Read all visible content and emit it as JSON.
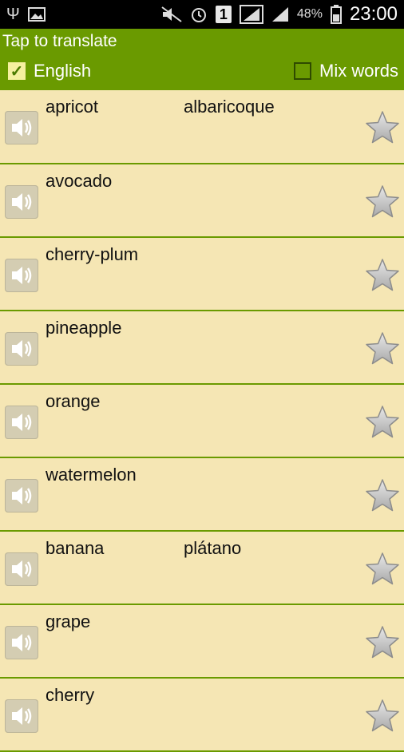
{
  "status_bar": {
    "signal_badge": "1",
    "battery": "48%",
    "time": "23:00"
  },
  "header": {
    "title": "Tap to translate",
    "english_checkbox": {
      "label": "English",
      "checked": true
    },
    "mix_words_checkbox": {
      "label": "Mix words",
      "checked": false
    }
  },
  "words": [
    {
      "word": "apricot",
      "translation": "albaricoque"
    },
    {
      "word": "avocado",
      "translation": ""
    },
    {
      "word": "cherry-plum",
      "translation": ""
    },
    {
      "word": "pineapple",
      "translation": ""
    },
    {
      "word": "orange",
      "translation": ""
    },
    {
      "word": "watermelon",
      "translation": ""
    },
    {
      "word": "banana",
      "translation": "plátano"
    },
    {
      "word": "grape",
      "translation": ""
    },
    {
      "word": "cherry",
      "translation": ""
    }
  ],
  "colors": {
    "header": "#6a9a00",
    "list_bg": "#f5e6b4"
  }
}
